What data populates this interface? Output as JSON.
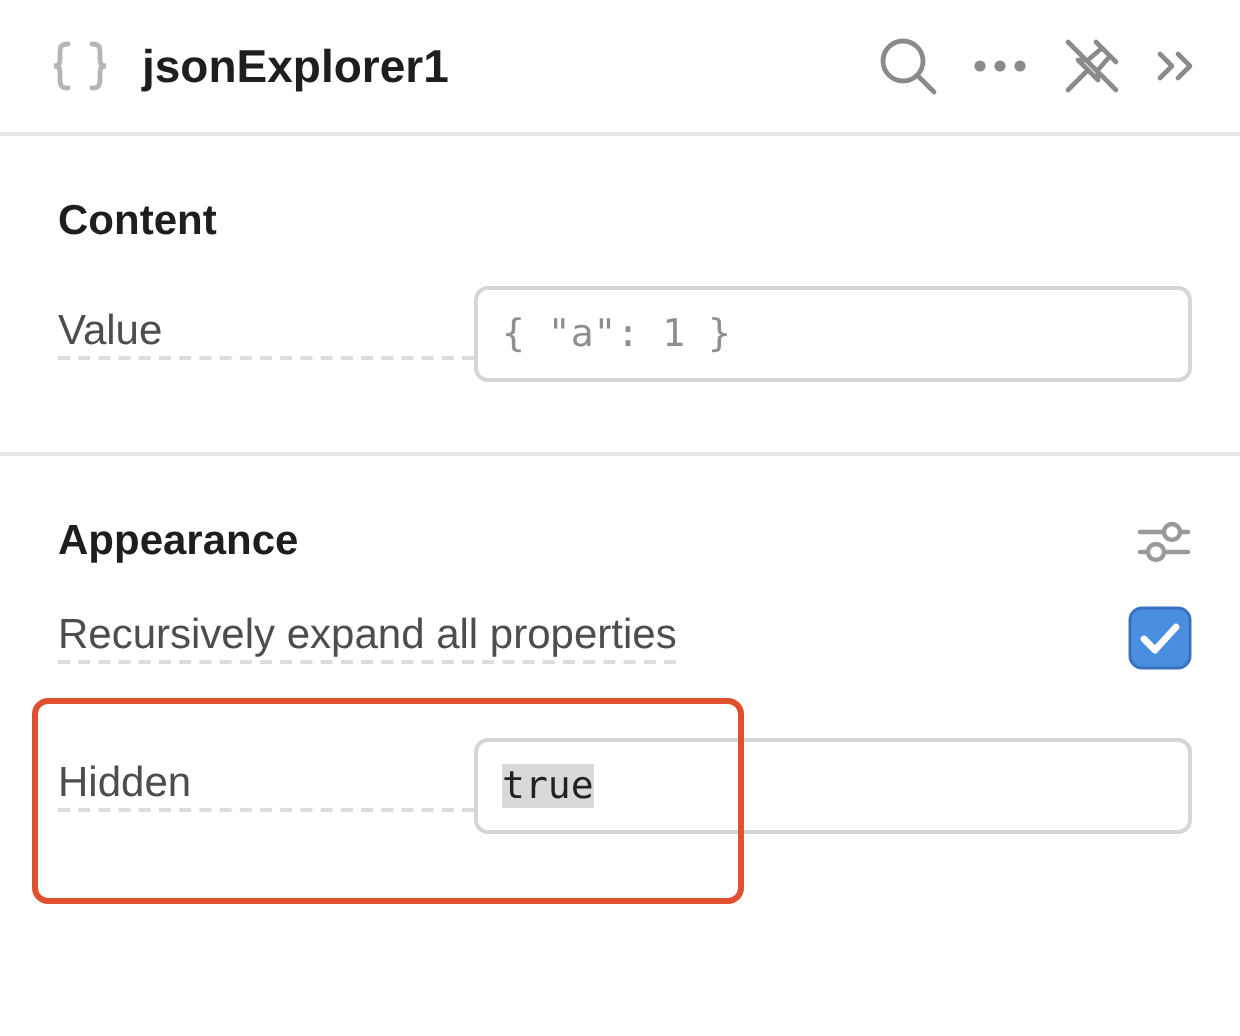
{
  "panel": {
    "title": "jsonExplorer1"
  },
  "sections": [
    {
      "title": "Content",
      "has_settings": false,
      "properties": [
        {
          "kind": "text-field",
          "label": "Value",
          "placeholder": "{ \"a\": 1 }",
          "annotated": false
        }
      ]
    },
    {
      "title": "Appearance",
      "has_settings": true,
      "properties": [
        {
          "kind": "checkbox",
          "label": "Recursively expand all properties",
          "checked": true,
          "annotated": false
        },
        {
          "kind": "text-field",
          "label": "Hidden",
          "value": "true",
          "highlighted": true,
          "annotated": true
        }
      ]
    }
  ]
}
